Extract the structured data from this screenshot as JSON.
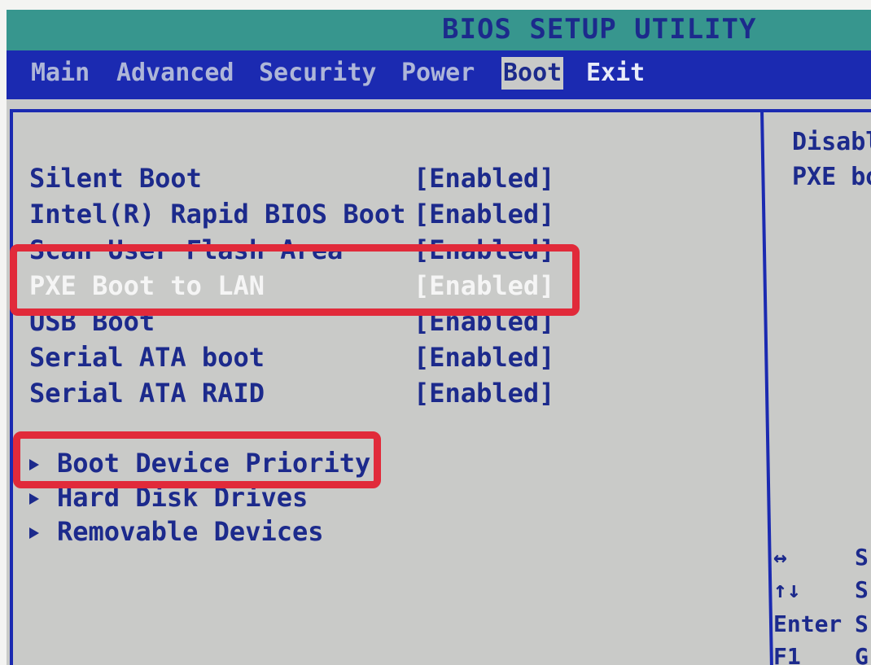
{
  "title": "BIOS SETUP UTILITY",
  "menu": {
    "items": [
      {
        "label": "Main"
      },
      {
        "label": "Advanced"
      },
      {
        "label": "Security"
      },
      {
        "label": "Power"
      },
      {
        "label": "Boot"
      },
      {
        "label": "Exit"
      }
    ],
    "active": "Boot"
  },
  "options": [
    {
      "label": "Silent Boot",
      "value": "[Enabled]"
    },
    {
      "label": "Intel(R) Rapid BIOS Boot",
      "value": "[Enabled]"
    },
    {
      "label": "Scan User Flash Area",
      "value": "[Enabled]"
    },
    {
      "label": "PXE Boot to LAN",
      "value": "[Enabled]"
    },
    {
      "label": "USB Boot",
      "value": "[Enabled]"
    },
    {
      "label": "Serial ATA boot",
      "value": "[Enabled]"
    },
    {
      "label": "Serial ATA RAID",
      "value": "[Enabled]"
    }
  ],
  "selected_option": "PXE Boot to LAN",
  "submenus": [
    {
      "label": "Boot Device Priority"
    },
    {
      "label": "Hard Disk Drives"
    },
    {
      "label": "Removable Devices"
    }
  ],
  "help": {
    "lines": [
      "Disabl",
      "PXE bo"
    ]
  },
  "keys": [
    {
      "key": "↔",
      "desc": "S"
    },
    {
      "key": "↑↓",
      "desc": "S"
    },
    {
      "key": "Enter",
      "desc": "S"
    },
    {
      "key": "F1",
      "desc": "G"
    }
  ],
  "colors": {
    "title_bar": "#37968e",
    "menu_bar": "#1b2ab1",
    "panel": "#c9cac8",
    "text": "#1c2a8c",
    "annotation": "#e12a3a"
  }
}
